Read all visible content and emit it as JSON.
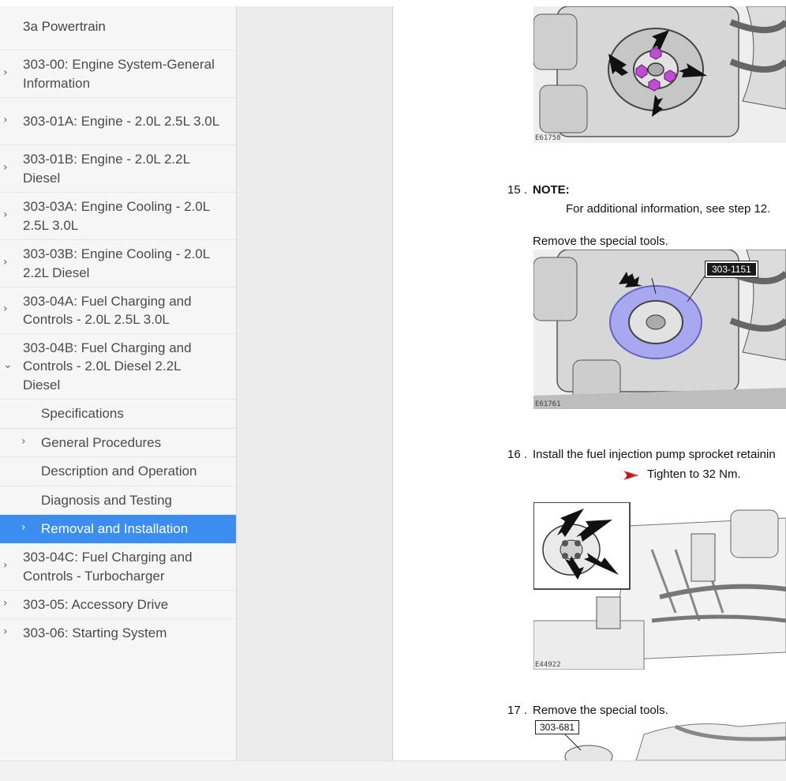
{
  "sidebar": {
    "section_title": "3a Powertrain",
    "items": [
      {
        "label": "303-00: Engine System-General Information"
      },
      {
        "label": "303-01A: Engine - 2.0L 2.5L 3.0L"
      },
      {
        "label": "303-01B: Engine - 2.0L 2.2L Diesel"
      },
      {
        "label": "303-03A: Engine Cooling - 2.0L 2.5L 3.0L"
      },
      {
        "label": "303-03B: Engine Cooling - 2.0L 2.2L Diesel"
      },
      {
        "label": "303-04A: Fuel Charging and Controls - 2.0L 2.5L 3.0L"
      },
      {
        "label": "303-04B: Fuel Charging and Controls - 2.0L Diesel 2.2L Diesel"
      }
    ],
    "subitems": [
      {
        "label": "Specifications"
      },
      {
        "label": "General Procedures"
      },
      {
        "label": "Description and Operation"
      },
      {
        "label": "Diagnosis and Testing"
      },
      {
        "label": "Removal and Installation"
      }
    ],
    "items_after": [
      {
        "label": "303-04C: Fuel Charging and Controls - Turbocharger"
      },
      {
        "label": "303-05: Accessory Drive"
      },
      {
        "label": "303-06: Starting System"
      }
    ],
    "chevron_closed": "›",
    "chevron_open": "⌄",
    "active_color": "#3b8ef0"
  },
  "document": {
    "fig1_code": "E61758",
    "step15_num": "15 .",
    "step15_note": "NOTE:",
    "step15_note_text": "For additional information, see step 12.",
    "step15_text": "Remove the special tools.",
    "fig2_code": "E61761",
    "fig2_callout": "303-1151",
    "step16_num": "16 .",
    "step16_text": "Install the fuel injection pump sprocket retainin",
    "step16_torque": "Tighten to 32 Nm.",
    "fig3_code": "E44922",
    "step17_num": "17 .",
    "step17_text": "Remove the special tools.",
    "fig4_callout": "303-681",
    "torque_icon": "torque-arrow-icon",
    "highlight_color": "#c24bd6",
    "tool_color": "#a8a8f0"
  }
}
